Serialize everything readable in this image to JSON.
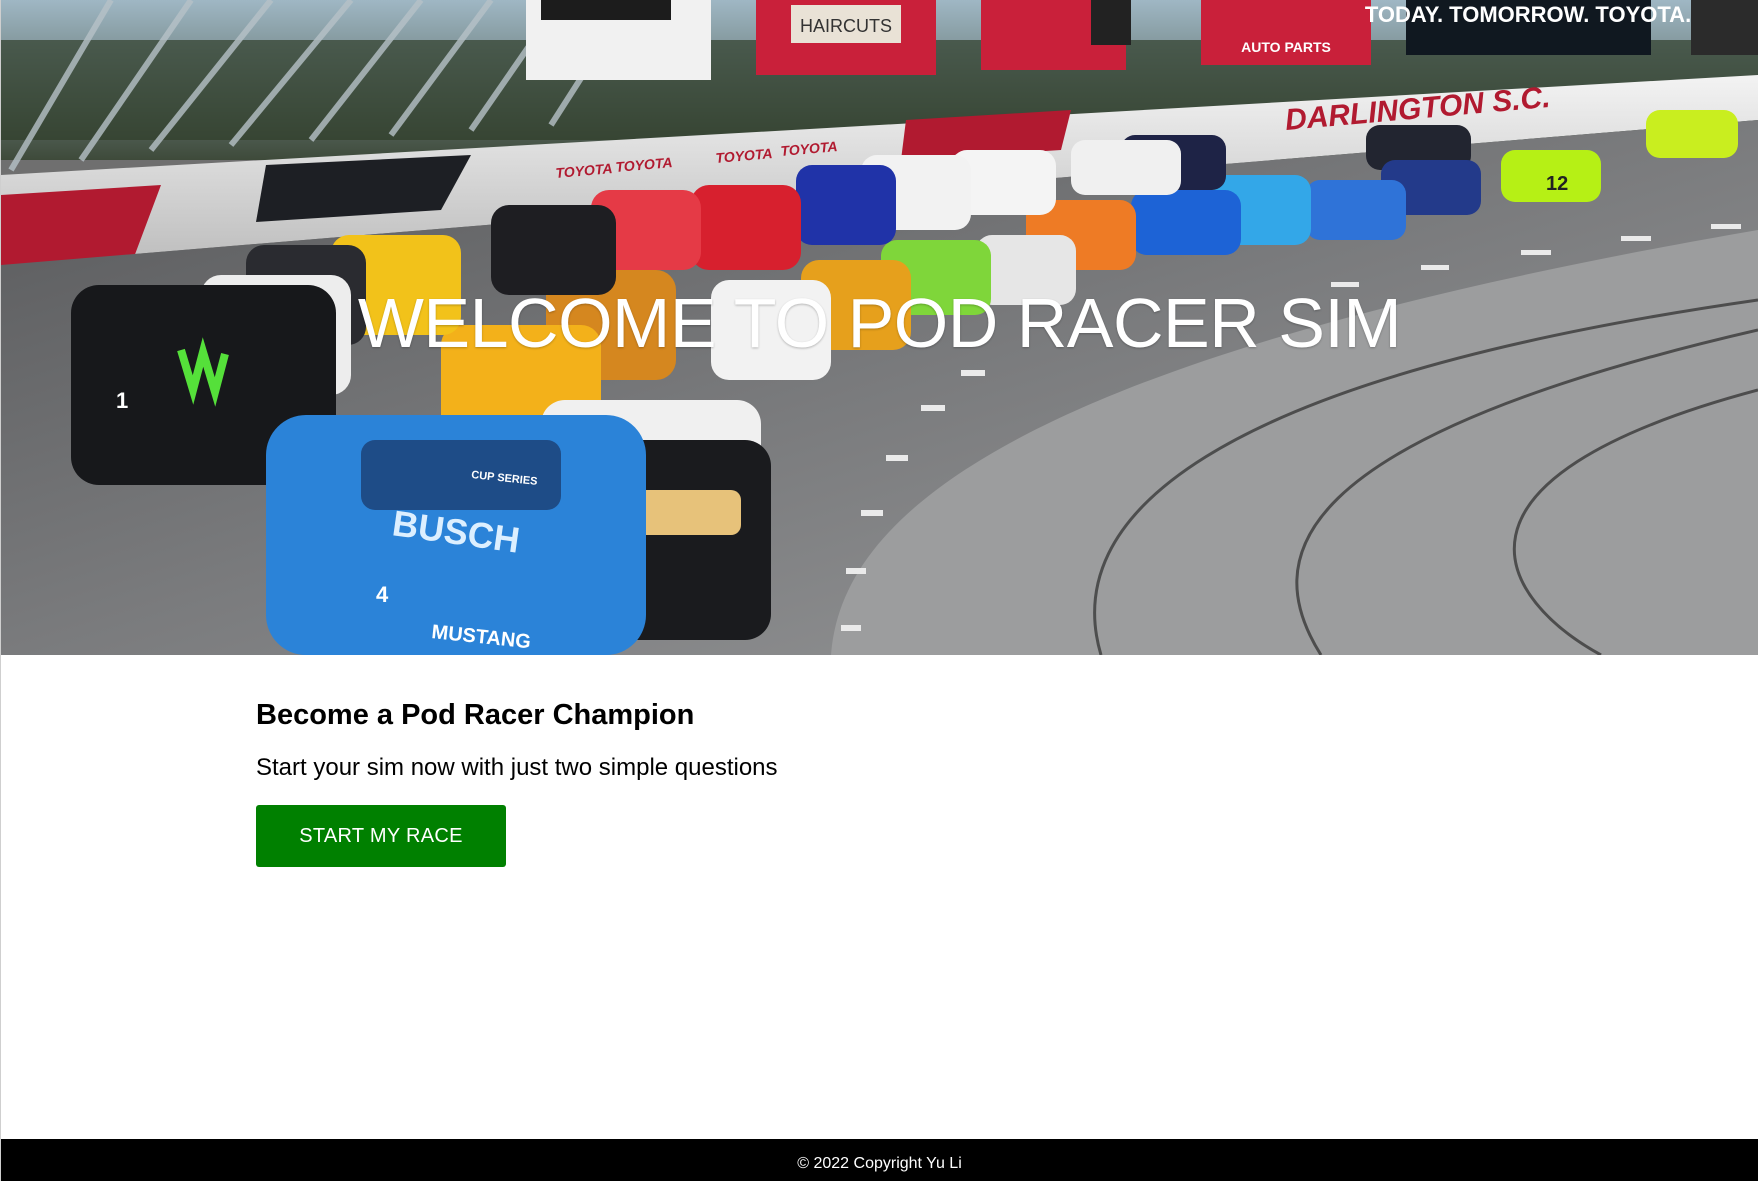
{
  "hero": {
    "title": "WELCOME TO POD RACER SIM",
    "image_alt": "NASCAR race cars on a banked oval track",
    "signage": {
      "track_name": "DARLINGTON S.C.",
      "billboard_slogan": "TODAY. TOMORROW. TOYOTA.",
      "billboard_haircuts": "HAIRCUTS",
      "billboard_autoparts": "AUTO PARTS",
      "wall_sponsor": "TOYOTA",
      "car_series": "CUP SERIES",
      "car_make": "MUSTANG",
      "car_sponsor": "BUSCH",
      "car_number_1": "1",
      "car_number_4": "4",
      "car_number_12": "12"
    }
  },
  "main": {
    "heading": "Become a Pod Racer Champion",
    "description": "Start your sim now with just two simple questions",
    "start_button_label": "START MY RACE"
  },
  "footer": {
    "copyright": "© 2022 Copyright Yu Li"
  },
  "colors": {
    "button_bg": "#008000",
    "footer_bg": "#000000",
    "hero_title": "#ffffff"
  }
}
